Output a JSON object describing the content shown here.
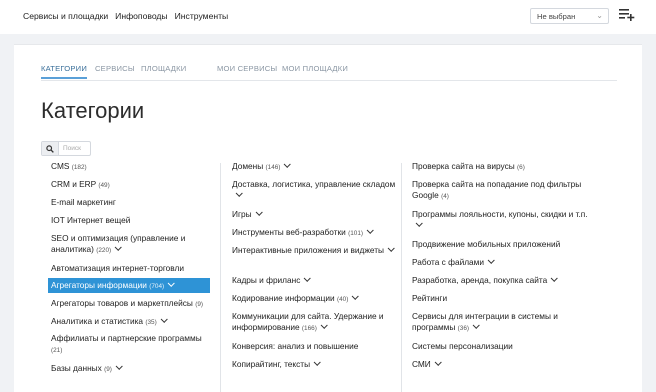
{
  "topnav": [
    "Сервисы и площадки",
    "Инфоповоды",
    "Инструменты"
  ],
  "select": {
    "value": "Не выбран"
  },
  "tabs": [
    "КАТЕГОРИИ",
    "СЕРВИСЫ",
    "ПЛОЩАДКИ",
    "МОИ СЕРВИСЫ",
    "МОИ ПЛОЩАДКИ"
  ],
  "title": "Категории",
  "search": {
    "placeholder": "Поиск"
  },
  "columns": [
    [
      {
        "label": "CMS",
        "count": "(182)",
        "chevron": false
      },
      {
        "label": "CRM и ERP",
        "count": "(49)",
        "chevron": false
      },
      {
        "label": "E-mail маркетинг",
        "count": "",
        "chevron": false
      },
      {
        "label": "IOT Интернет вещей",
        "count": "",
        "chevron": false
      },
      {
        "label": "SEO и оптимизация (управление и аналитика)",
        "count": "(220)",
        "chevron": true
      },
      {
        "label": "Автоматизация интернет-торговли",
        "count": "",
        "chevron": false
      },
      {
        "label": "Агрегаторы информации",
        "count": "(704)",
        "chevron": true,
        "active": true
      },
      {
        "label": "Агрегаторы товаров и маркетплейсы",
        "count": "(9)",
        "chevron": false
      },
      {
        "label": "Аналитика и статистика",
        "count": "(35)",
        "chevron": true
      },
      {
        "label": "Аффилиаты и партнерские программы",
        "count": "(21)",
        "chevron": false
      },
      {
        "label": "Базы данных",
        "count": "(9)",
        "chevron": true
      }
    ],
    [
      {
        "label": "Домены",
        "count": "(146)",
        "chevron": true
      },
      {
        "label": "Доставка, логистика, управление складом",
        "count": "",
        "chevron": true
      },
      {
        "label": "Игры",
        "count": "",
        "chevron": true
      },
      {
        "label": "Инструменты веб-разработки",
        "count": "(101)",
        "chevron": true
      },
      {
        "label": "Интерактивные приложения и виджеты",
        "count": "",
        "chevron": true
      },
      {
        "label": "Кадры и фриланс",
        "count": "",
        "chevron": true
      },
      {
        "label": "Кодирование информации",
        "count": "(40)",
        "chevron": true
      },
      {
        "label": "Коммуникации для сайта. Удержание и информирование",
        "count": "(166)",
        "chevron": true
      },
      {
        "label": "Конверсия: анализ и повышение",
        "count": "",
        "chevron": false
      },
      {
        "label": "Копирайтинг, тексты",
        "count": "",
        "chevron": true
      }
    ],
    [
      {
        "label": "Проверка сайта на вирусы",
        "count": "(6)",
        "chevron": false
      },
      {
        "label": "Проверка сайта на попадание под фильтры Google",
        "count": "(4)",
        "chevron": false
      },
      {
        "label": "Программы лояльности, купоны, скидки и т.п.",
        "count": "",
        "chevron": true
      },
      {
        "label": "Продвижение мобильных приложений",
        "count": "",
        "chevron": false
      },
      {
        "label": "Работа с файлами",
        "count": "",
        "chevron": true
      },
      {
        "label": "Разработка, аренда, покупка сайта",
        "count": "",
        "chevron": true
      },
      {
        "label": "Рейтинги",
        "count": "",
        "chevron": false
      },
      {
        "label": "Сервисы для интеграции в системы и программы",
        "count": "(36)",
        "chevron": true
      },
      {
        "label": "Системы персонализации",
        "count": "",
        "chevron": false
      },
      {
        "label": "СМИ",
        "count": "",
        "chevron": true
      }
    ]
  ]
}
